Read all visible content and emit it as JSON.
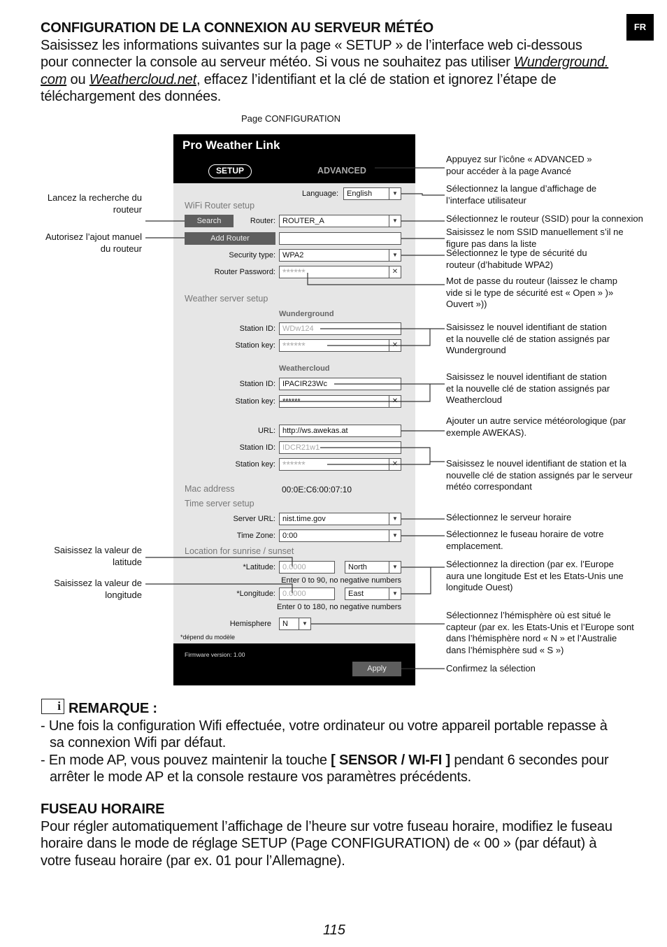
{
  "lang_badge": "FR",
  "intro": {
    "title": "CONFIGURATION DE LA CONNEXION AU SERVEUR MÉTÉO",
    "l1": "Saisissez les informations suivantes sur la page « SETUP » de l’interface web ci-dessous",
    "l2a": "pour connecter la console au serveur météo. Si vous ne souhaitez pas utiliser ",
    "l2b": "Wunderground.",
    "l3a": "com",
    "l3b": " ou ",
    "l3c": "Weathercloud.net",
    "l3d": ", effacez l’identifiant et la clé de station et ignorez l’étape de",
    "l4": "téléchargement des données."
  },
  "figure_caption": "Page CONFIGURATION",
  "ui": {
    "app_title": "Pro Weather Link",
    "tab_setup": "SETUP",
    "tab_advanced": "ADVANCED",
    "language_label": "Language:",
    "language_value": "English",
    "wifi_section": "WiFi Router setup",
    "search_btn": "Search",
    "router_label": "Router:",
    "router_value": "ROUTER_A",
    "add_router_btn": "Add Router",
    "add_router_value": "",
    "security_label": "Security type:",
    "security_value": "WPA2",
    "password_label": "Router Password:",
    "password_value": "******",
    "weather_section": "Weather server setup",
    "wu_title": "Wunderground",
    "wu_id_label": "Station ID:",
    "wu_id_value": "WDw124",
    "wu_key_label": "Station key:",
    "wu_key_value": "******",
    "wc_title": "Weathercloud",
    "wc_id_label": "Station ID:",
    "wc_id_value": "IPACIR23Wc",
    "wc_key_label": "Station key:",
    "wc_key_value": "******",
    "url_label": "URL:",
    "url_value": "http://ws.awekas.at",
    "aw_id_label": "Station ID:",
    "aw_id_value": "IDCR21w1",
    "aw_key_label": "Station key:",
    "aw_key_value": "******",
    "mac_label": "Mac address",
    "mac_value": "00:0E:C6:00:07:10",
    "time_section": "Time server setup",
    "server_label": "Server URL:",
    "server_value": "nist.time.gov",
    "tz_label": "Time Zone:",
    "tz_value": "0:00",
    "loc_section": "Location for sunrise / sunset",
    "lat_label": "*Latitude:",
    "lat_value": "0.0000",
    "lat_dir": "North",
    "lat_hint": "Enter 0 to 90, no negative numbers",
    "lon_label": "*Longitude:",
    "lon_value": "0.0000",
    "lon_dir": "East",
    "lon_hint": "Enter 0 to 180, no negative numbers",
    "hemi_label": "Hemisphere",
    "hemi_value": "N",
    "model_note": "*dépend du modèle",
    "firmware": "Firmware version: 1.00",
    "apply_btn": "Apply"
  },
  "annotations_right": [
    [
      "Appuyez sur l’icône « ADVANCED »",
      "pour accéder à la page Avancé"
    ],
    [
      "Sélectionnez la langue d’affichage de",
      "l’interface utilisateur"
    ],
    [
      "Sélectionnez le routeur (SSID) pour la connexion"
    ],
    [
      "Saisissez le nom SSID manuellement s’il ne",
      "figure pas dans la liste"
    ],
    [
      "Sélectionnez le type de sécurité du",
      "routeur (d’habitude WPA2)"
    ],
    [
      "Mot de passe du routeur (laissez le champ",
      "vide si le type de sécurité est « Open » )»",
      "Ouvert »))"
    ],
    [
      "Saisissez le nouvel identifiant de station",
      "et la nouvelle clé de station assignés par",
      "Wunderground"
    ],
    [
      "Saisissez le nouvel identifiant de station",
      "et la nouvelle clé de station assignés par",
      "Weathercloud"
    ],
    [
      "Ajouter un autre service météorologique (par",
      "exemple AWEKAS)."
    ],
    [
      "Saisissez le nouvel identifiant de station et la",
      "nouvelle clé de station assignés par le serveur",
      "météo correspondant"
    ],
    [
      "Sélectionnez le serveur horaire"
    ],
    [
      "Sélectionnez le fuseau horaire de votre",
      "emplacement."
    ],
    [
      "Sélectionnez la direction (par ex. l’Europe",
      "aura une longitude Est et les Etats-Unis une",
      "longitude Ouest)"
    ],
    [
      "Sélectionnez l’hémisphère où est situé le",
      "capteur (par ex. les Etats-Unis et l’Europe sont",
      "dans l’hémisphère nord « N » et l’Australie",
      "dans l’hémisphère sud « S »)"
    ],
    [
      "Confirmez la sélection"
    ]
  ],
  "annotations_left": [
    [
      "Lancez la recherche du",
      "routeur"
    ],
    [
      "Autorisez l’ajout manuel",
      "du routeur"
    ],
    [
      "Saisissez la valeur de",
      "latitude"
    ],
    [
      "Saisissez la valeur de",
      "longitude"
    ]
  ],
  "note": {
    "title": "REMARQUE :",
    "b1a": "- Une fois la configuration Wifi effectuée, votre ordinateur ou votre appareil portable repasse à",
    "b1b": "sa connexion Wifi par défaut.",
    "b2a": "- En mode AP, vous pouvez maintenir la touche ",
    "b2key": "[ SENSOR / WI-FI ]",
    "b2b": " pendant 6 secondes pour",
    "b2c": "arrêter le mode AP et la console restaure vos paramètres précédents."
  },
  "tz": {
    "title": "FUSEAU HORAIRE",
    "l1": "Pour régler automatiquement l’affichage de l’heure sur votre fuseau horaire, modifiez le fuseau",
    "l2": "horaire dans le mode de réglage SETUP (Page CONFIGURATION) de « 00 » (par défaut) à",
    "l3": "votre fuseau horaire (par ex. 01 pour l’Allemagne)."
  },
  "page_number": "115"
}
